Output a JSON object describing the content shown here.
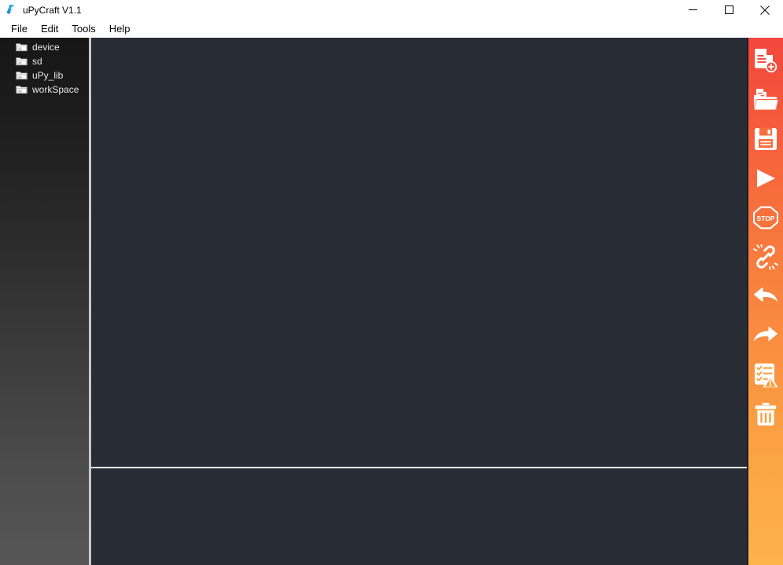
{
  "window": {
    "title": "uPyCraft V1.1",
    "logo_icon": "upycraft-logo-icon",
    "controls": {
      "minimize": "minimize-icon",
      "maximize": "maximize-icon",
      "close": "close-icon"
    }
  },
  "menubar": {
    "items": [
      {
        "label": "File"
      },
      {
        "label": "Edit"
      },
      {
        "label": "Tools"
      },
      {
        "label": "Help"
      }
    ]
  },
  "sidebar": {
    "items": [
      {
        "label": "device",
        "icon": "folder-icon"
      },
      {
        "label": "sd",
        "icon": "folder-icon"
      },
      {
        "label": "uPy_lib",
        "icon": "folder-icon"
      },
      {
        "label": "workSpace",
        "icon": "folder-icon"
      }
    ]
  },
  "editor": {
    "content": "",
    "background": "#272c35"
  },
  "terminal": {
    "content": "",
    "background": "#272c35"
  },
  "toolbar": {
    "background_top": "#f2473d",
    "background_bottom": "#fdb24a",
    "buttons": [
      {
        "name": "new-file-button",
        "icon": "new-file-icon",
        "label": "New"
      },
      {
        "name": "open-file-button",
        "icon": "open-folder-icon",
        "label": "Open"
      },
      {
        "name": "save-file-button",
        "icon": "save-floppy-icon",
        "label": "Save"
      },
      {
        "name": "run-button",
        "icon": "play-icon",
        "label": "Run"
      },
      {
        "name": "stop-button",
        "icon": "stop-sign-icon",
        "label": "Stop"
      },
      {
        "name": "disconnect-button",
        "icon": "broken-chain-icon",
        "label": "Disconnect"
      },
      {
        "name": "undo-button",
        "icon": "undo-arrow-icon",
        "label": "Undo"
      },
      {
        "name": "redo-button",
        "icon": "redo-arrow-icon",
        "label": "Redo"
      },
      {
        "name": "syntax-check-button",
        "icon": "checklist-warning-icon",
        "label": "Syntax Check"
      },
      {
        "name": "delete-button",
        "icon": "trash-icon",
        "label": "Delete"
      }
    ]
  }
}
